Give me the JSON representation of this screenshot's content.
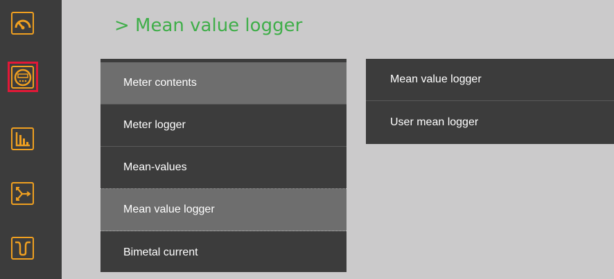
{
  "page": {
    "title": "> Mean value logger"
  },
  "sidebar": {
    "items": [
      {
        "icon": "gauge-icon"
      },
      {
        "icon": "meter-icon",
        "selected": true
      },
      {
        "icon": "bar-chart-icon"
      },
      {
        "icon": "phasor-icon"
      },
      {
        "icon": "waveform-dip-icon"
      }
    ],
    "selected_color": "#e31837",
    "icon_color": "#f0a020"
  },
  "left_menu": {
    "items": [
      {
        "label": "Meter contents",
        "active": true
      },
      {
        "label": "Meter logger"
      },
      {
        "label": "Mean-values"
      },
      {
        "label": "Mean value logger",
        "active": true
      },
      {
        "label": "Bimetal current"
      }
    ]
  },
  "right_menu": {
    "items": [
      {
        "label": "Mean value logger"
      },
      {
        "label": "User mean logger"
      }
    ]
  },
  "colors": {
    "title": "#3fae49",
    "menu_bg": "#3c3c3c",
    "menu_active_bg": "#6e6e6e",
    "page_bg": "#cbcacb"
  }
}
